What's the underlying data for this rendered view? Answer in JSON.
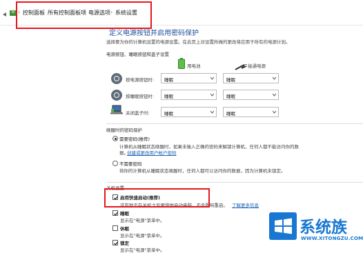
{
  "breadcrumb": {
    "items": [
      "控制面板",
      "所有控制面板项",
      "电源选项",
      "系统设置"
    ],
    "separator": "›"
  },
  "header": {
    "title": "定义电源按钮并启用密码保护",
    "description": "选择要为你的计算机设置的电源设置。在此页上对设置所做的更改将应用于所有的电源计划。"
  },
  "power_buttons": {
    "section_label": "电源按钮、睡眠按钮和盖子设置",
    "battery_label": "用电池",
    "plugged_label": "接通电源",
    "rows": [
      {
        "label": "按电源按钮时:",
        "battery": "睡眠",
        "plugged": "睡眠"
      },
      {
        "label": "按睡眠按钮时:",
        "battery": "睡眠",
        "plugged": "睡眠"
      },
      {
        "label": "关闭盖子时:",
        "battery": "睡眠",
        "plugged": "睡眠"
      }
    ]
  },
  "wake_password": {
    "section_label": "唤醒时的密码保护",
    "require": {
      "label": "需要密码(推荐)",
      "desc": "计算机从睡眠状态唤醒时，如果未输入正确的密码来解锁计算机，任何人都不能访问你的数",
      "desc2": "据。",
      "link": "创建或更改用户帐户密码"
    },
    "no_require": {
      "label": "不需要密码",
      "desc": "将你的计算机从睡眠状态唤醒时，任何人都可以访问你的数据，因为计算机未锁定。"
    }
  },
  "shutdown": {
    "section_label": "关机设置",
    "fast_startup": {
      "label": "启用快速启动(推荐)",
      "desc": "这有助于在关机之后更快地启动电脑。不会影响重启。",
      "link": "了解更多信息"
    },
    "sleep": {
      "label": "睡眠",
      "desc": "显示在\"电源\"菜单中。"
    },
    "hibernate": {
      "label": "休眠",
      "desc": "显示在\"电源\"菜单中。"
    },
    "lock": {
      "label": "锁定",
      "desc": "显示在\"电源\"菜单中。"
    }
  },
  "watermark": {
    "brand": "系统族",
    "url": "WWW.XITONGZU.COM"
  },
  "colors": {
    "highlight": "#e8141b",
    "link": "#1a5fb4",
    "title": "#1f4e9c",
    "brand": "#1877d2"
  }
}
